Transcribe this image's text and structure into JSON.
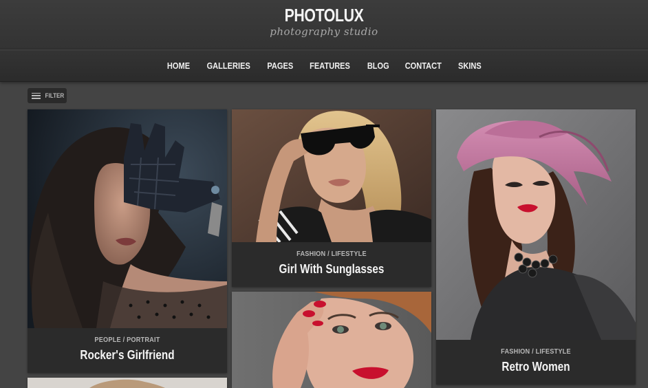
{
  "brand": {
    "title": "PHOTOLUX",
    "subtitle": "photography studio"
  },
  "nav": [
    "HOME",
    "GALLERIES",
    "PAGES",
    "FEATURES",
    "BLOG",
    "CONTACT",
    "SKINS"
  ],
  "filter": {
    "label": "FILTER"
  },
  "cards": [
    {
      "category": "PEOPLE / PORTRAIT",
      "title": "Rocker's Girlfriend"
    },
    {
      "category": "FASHION / LIFESTYLE",
      "title": "Girl With Sunglasses"
    },
    {
      "category": "FASHION / LIFESTYLE",
      "title": "Retro Women"
    }
  ],
  "colors": {
    "background": "#444444",
    "header": "#383838",
    "caption": "#2b2b2b",
    "lipstick": "#c8102e",
    "hat": "#c77aa3"
  }
}
